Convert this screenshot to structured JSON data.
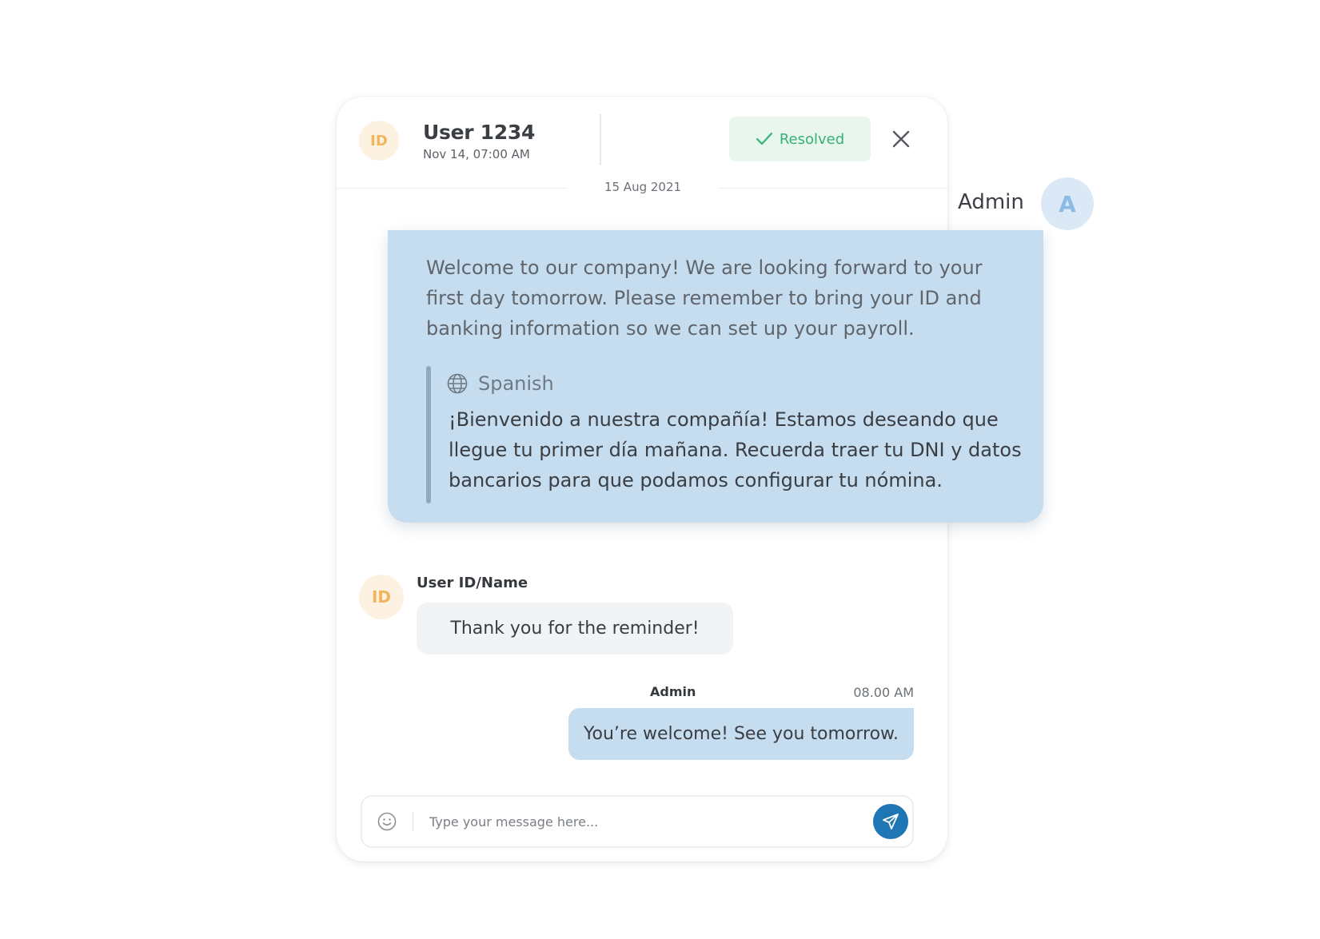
{
  "header": {
    "avatar_initials": "ID",
    "user_name": "User 1234",
    "timestamp": "Nov 14, 07:00 AM",
    "status_label": "Resolved",
    "status_color": "#37b276"
  },
  "date_separator": "15 Aug 2021",
  "floating_sender": {
    "name": "Admin",
    "avatar_initial": "A"
  },
  "translation_card": {
    "original_text": "Welcome to our company! We are looking forward to your first day tomorrow. Please remember to bring your ID and banking information so we can set up your payroll.",
    "language_icon": "globe-icon",
    "language": "Spanish",
    "translated_text": "¡Bienvenido a nuestra compañía! Estamos deseando que llegue tu primer día mañana. Recuerda traer tu DNI y datos bancarios para que podamos configurar tu nómina."
  },
  "messages": [
    {
      "sender": "User ID/Name",
      "avatar_initials": "ID",
      "text": "Thank you for the reminder!"
    },
    {
      "sender": "Admin",
      "time": "08.00 AM",
      "text": "You’re welcome! See you tomorrow."
    }
  ],
  "composer": {
    "placeholder": "Type your message here...",
    "emoji_icon": "smiley-icon",
    "send_icon": "paper-plane-icon"
  },
  "colors": {
    "accent": "#1e76b5",
    "bubble_blue": "#c6ddf0",
    "avatar_orange": "#f2b55b"
  }
}
